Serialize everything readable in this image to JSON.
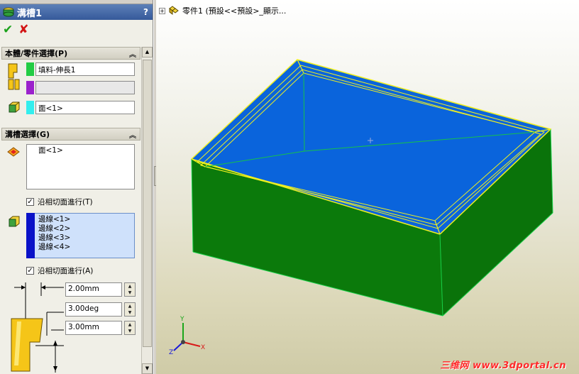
{
  "property_manager": {
    "title": "溝槽1",
    "help": "?",
    "ok_icon": "check-icon",
    "cancel_icon": "x-icon",
    "body_group": {
      "header": "本體/零件選擇(P)",
      "body_value": "填料-伸長1",
      "face_value": "面<1>",
      "swatch_colors": [
        "#22cc44",
        "#9b22cc",
        "#33eeee"
      ]
    },
    "groove_group": {
      "header": "溝槽選擇(G)",
      "face_list": [
        "面<1>"
      ],
      "tangent1_label": "沿相切面進行(T)",
      "edge_list": [
        "邊線<1>",
        "邊線<2>",
        "邊線<3>",
        "邊線<4>"
      ],
      "tangent2_label": "沿相切面進行(A)",
      "width_value": "2.00mm",
      "angle_value": "3.00deg",
      "depth_value": "3.00mm"
    }
  },
  "viewport": {
    "tree_label": "零件1  (預設<<預設>_顯示...",
    "triad": {
      "x": "X",
      "y": "Y",
      "z": "Z"
    },
    "watermark": "三维网 www.3dportal.cn",
    "colors": {
      "top_face": "#0a64dc",
      "side_face": "#0b7a0b",
      "edge_highlight": "#f0f020"
    }
  }
}
